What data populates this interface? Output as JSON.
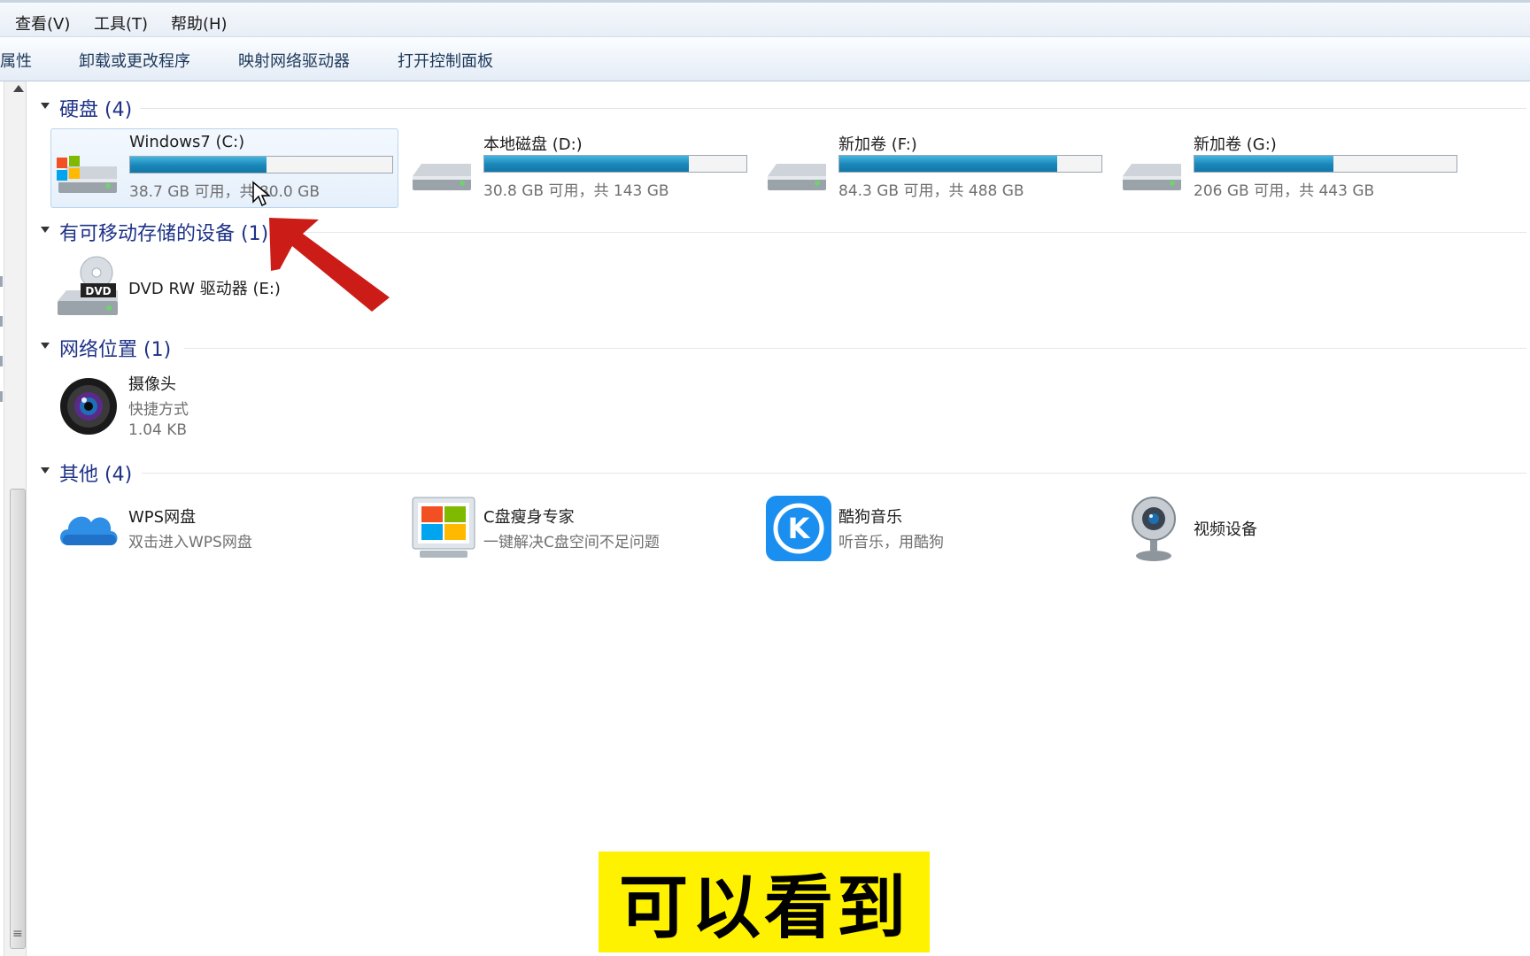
{
  "menu": [
    "查看(V)",
    "工具(T)",
    "帮助(H)"
  ],
  "toolbar": [
    "属性",
    "卸载或更改程序",
    "映射网络驱动器",
    "打开控制面板"
  ],
  "groups": {
    "hard_disks": {
      "label": "硬盘 (4)"
    },
    "removable": {
      "label": "有可移动存储的设备 (1)"
    },
    "network": {
      "label": "网络位置 (1)"
    },
    "other": {
      "label": "其他 (4)"
    }
  },
  "drives": [
    {
      "name": "Windows7 (C:)",
      "usage": "38.7 GB 可用，共 80.0 GB",
      "used_fraction": 0.52,
      "icon": "windows-drive-icon"
    },
    {
      "name": "本地磁盘 (D:)",
      "usage": "30.8 GB 可用，共 143 GB",
      "used_fraction": 0.78,
      "icon": "hard-drive-icon"
    },
    {
      "name": "新加卷 (F:)",
      "usage": "84.3 GB 可用，共 488 GB",
      "used_fraction": 0.83,
      "icon": "hard-drive-icon"
    },
    {
      "name": "新加卷 (G:)",
      "usage": "206 GB 可用，共 443 GB",
      "used_fraction": 0.53,
      "icon": "hard-drive-icon"
    }
  ],
  "dvd": {
    "name": "DVD RW 驱动器 (E:)",
    "badge": "DVD",
    "icon": "dvd-drive-icon"
  },
  "network_item": {
    "name": "摄像头",
    "type": "快捷方式",
    "size": "1.04 KB",
    "icon": "camera-icon"
  },
  "others": [
    {
      "name": "WPS网盘",
      "desc": "双击进入WPS网盘",
      "icon": "cloud-icon"
    },
    {
      "name": "C盘瘦身专家",
      "desc": "一键解决C盘空间不足问题",
      "icon": "windows-monitor-icon"
    },
    {
      "name": "酷狗音乐",
      "desc": "听音乐，用酷狗",
      "icon": "kugou-icon",
      "letter": "K"
    },
    {
      "name": "视频设备",
      "desc": "",
      "icon": "webcam-icon"
    }
  ],
  "caption": "可以看到",
  "colors": {
    "accent_header": "#1e3287",
    "bar_fill": "#1a86b8",
    "caption_bg": "#fff200",
    "arrow": "#c8100c"
  }
}
